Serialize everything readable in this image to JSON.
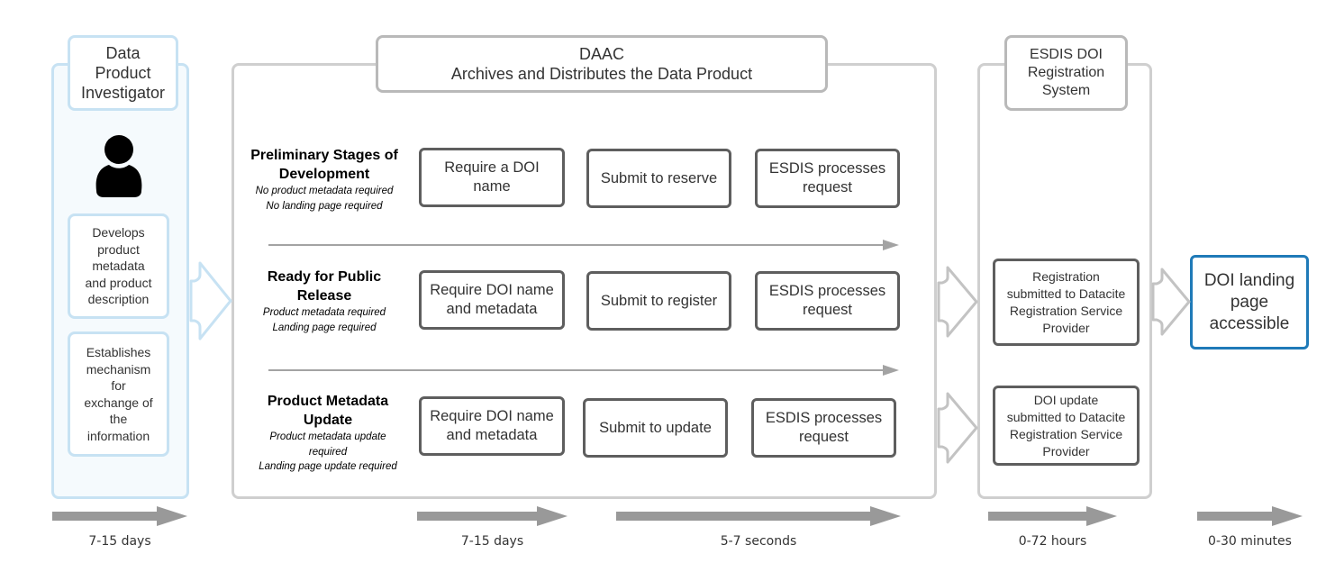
{
  "lanes": {
    "investigator": {
      "title": "Data Product Investigator",
      "title_lines": [
        "Data",
        "Product",
        "Investigator"
      ],
      "icon": "person-icon",
      "notes": [
        {
          "lines": [
            "Develops",
            "product",
            "metadata",
            "and product",
            "description"
          ]
        },
        {
          "lines": [
            "Establishes",
            "mechanism",
            "for",
            "exchange of",
            "the",
            "information"
          ]
        }
      ]
    },
    "daac": {
      "title_line1": "DAAC",
      "title_line2": "Archives and Distributes the Data Product",
      "stages": [
        {
          "title_lines": [
            "Preliminary Stages of",
            "Development"
          ],
          "subtitle_lines": [
            "No product metadata required",
            "No landing page required"
          ],
          "steps": [
            {
              "lines": [
                "Require a DOI",
                "name"
              ]
            },
            {
              "lines": [
                "Submit to reserve"
              ]
            },
            {
              "lines": [
                "ESDIS processes",
                "request"
              ]
            }
          ]
        },
        {
          "title_lines": [
            "Ready for Public",
            "Release"
          ],
          "subtitle_lines": [
            "Product metadata required",
            "Landing page required"
          ],
          "steps": [
            {
              "lines": [
                "Require DOI name",
                "and metadata"
              ]
            },
            {
              "lines": [
                "Submit to register"
              ]
            },
            {
              "lines": [
                "ESDIS processes",
                "request"
              ]
            }
          ]
        },
        {
          "title_lines": [
            "Product Metadata",
            "Update"
          ],
          "subtitle_lines": [
            "Product metadata update",
            "required",
            "Landing page update required"
          ],
          "steps": [
            {
              "lines": [
                "Require DOI name",
                "and metadata"
              ]
            },
            {
              "lines": [
                "Submit to update"
              ]
            },
            {
              "lines": [
                "ESDIS processes",
                "request"
              ]
            }
          ]
        }
      ]
    },
    "esdis": {
      "title_lines": [
        "ESDIS DOI",
        "Registration",
        "System"
      ],
      "steps": [
        {
          "lines": [
            "Registration",
            "submitted to Datacite",
            "Registration Service",
            "Provider"
          ]
        },
        {
          "lines": [
            "DOI update",
            "submitted to Datacite",
            "Registration Service",
            "Provider"
          ]
        }
      ]
    },
    "final": {
      "lines": [
        "DOI landing",
        "page",
        "accessible"
      ]
    }
  },
  "durations": [
    {
      "label": "7-15 days"
    },
    {
      "label": "7-15 days"
    },
    {
      "label": "5-7 seconds"
    },
    {
      "label": "0-72 hours"
    },
    {
      "label": "0-30 minutes"
    }
  ],
  "colors": {
    "investigator_border": "#c7e2f3",
    "investigator_fill": "#f5fafd",
    "lane_border": "#cfcfcf",
    "step_border": "#5e5e5e",
    "final_border": "#1f7ab8",
    "arrow": "#999999"
  }
}
